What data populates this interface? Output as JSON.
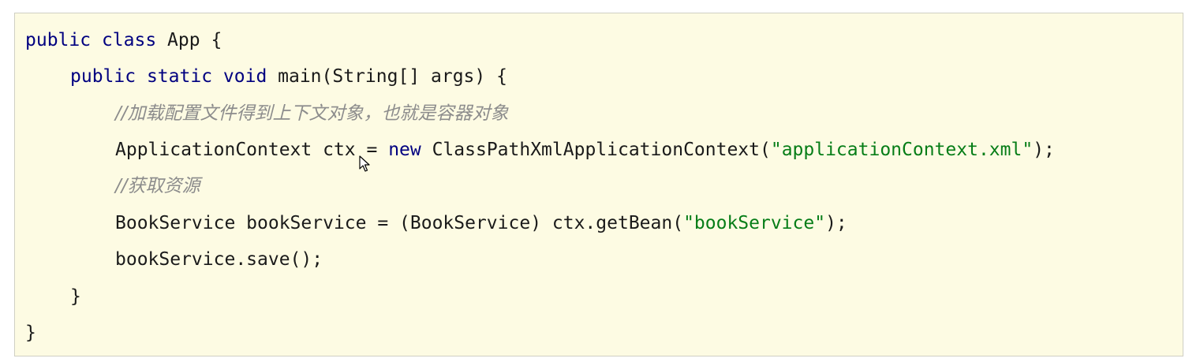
{
  "code": {
    "line1": {
      "kw_public": "public",
      "kw_class": "class",
      "rest": " App {"
    },
    "line2": {
      "kw_public": "public",
      "kw_static": "static",
      "kw_void": "void",
      "rest": " main(String[] args) {"
    },
    "line3": {
      "comment": "//加载配置文件得到上下文对象，也就是容器对象"
    },
    "line4": {
      "lhs": "ApplicationContext ctx = ",
      "kw_new": "new",
      "call": " ClassPathXmlApplicationContext(",
      "string": "\"applicationContext.xml\"",
      "end": ");"
    },
    "line5": {
      "comment": "//获取资源"
    },
    "line6": {
      "lhs": "BookService bookService = (BookService) ctx.getBean(",
      "string": "\"bookService\"",
      "end": ");"
    },
    "line7": {
      "text": "bookService.save();"
    },
    "line8": {
      "text": "}"
    },
    "line9": {
      "text": "}"
    }
  },
  "colors": {
    "background": "#fdfbe3",
    "keyword": "#000080",
    "string": "#067d17",
    "comment": "#8c8c8c"
  },
  "icons": {
    "cursor": "mouse-pointer-icon"
  }
}
